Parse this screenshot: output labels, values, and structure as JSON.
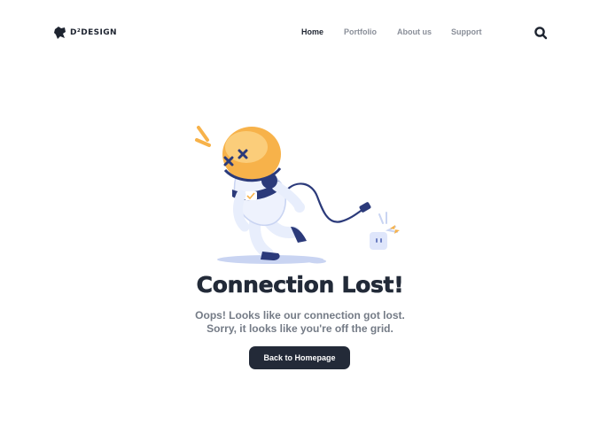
{
  "brand": {
    "name": "D²DESIGN",
    "color": "#1e2430"
  },
  "nav": {
    "items": [
      {
        "label": "Home",
        "active": true
      },
      {
        "label": "Portfolio",
        "active": false
      },
      {
        "label": "About us",
        "active": false
      },
      {
        "label": "Support",
        "active": false
      }
    ]
  },
  "search": {
    "icon": "search-icon"
  },
  "hero": {
    "illustration": "astronaut-unplugged-illustration",
    "title": "Connection Lost!",
    "subtitle_line1": "Oops! Looks like our connection got lost.",
    "subtitle_line2": "Sorry, it looks like you're off the grid.",
    "cta_label": "Back to Homepage"
  },
  "colors": {
    "accent_dark": "#232a38",
    "muted_text": "#747b86",
    "helmet_orange": "#f7b24a",
    "suit_navy": "#2b3a7a"
  }
}
